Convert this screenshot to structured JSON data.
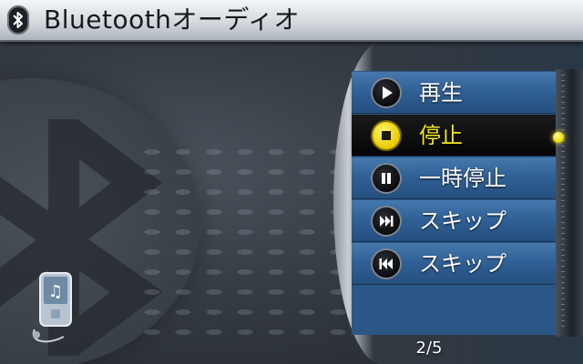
{
  "header": {
    "title": "Bluetoothオーディオ",
    "icon": "bluetooth-icon"
  },
  "menu": {
    "items": [
      {
        "label": "再生",
        "icon": "play-icon",
        "selected": false
      },
      {
        "label": "停止",
        "icon": "stop-icon",
        "selected": true
      },
      {
        "label": "一時停止",
        "icon": "pause-icon",
        "selected": false
      },
      {
        "label": "スキップ",
        "icon": "skip-forward-icon",
        "selected": false
      },
      {
        "label": "スキップ",
        "icon": "skip-back-icon",
        "selected": false
      }
    ],
    "page_indicator": "2/5"
  },
  "colors": {
    "header_bg": "#d9dde2",
    "menu_item_bg": "#2f5f94",
    "selected_bg": "#0a0a0a",
    "selected_text": "#f4e81c",
    "background": "#363c44"
  }
}
